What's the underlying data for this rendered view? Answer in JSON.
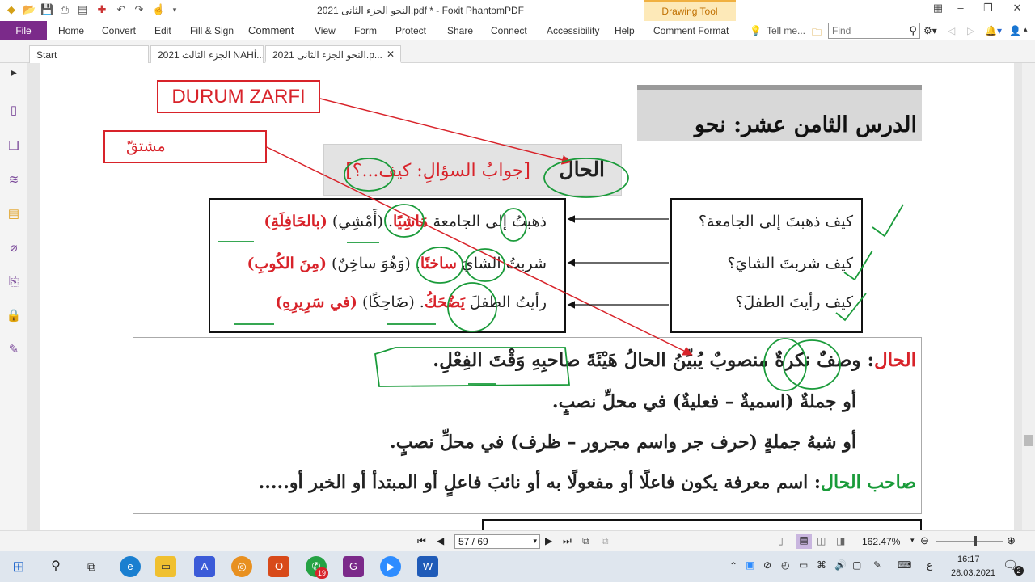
{
  "app": {
    "window_title": "النحو الجزء الثانى 2021.pdf * - Foxit PhantomPDF",
    "context_tab": "Drawing Tool"
  },
  "ribbon": {
    "file_label": "File",
    "menus": [
      "Home",
      "Convert",
      "Edit",
      "Fill & Sign",
      "Comment",
      "View",
      "Form",
      "Protect",
      "Share",
      "Connect",
      "Accessibility",
      "Help",
      "Comment Format"
    ],
    "tell_me": "Tell me...",
    "find_placeholder": "Find"
  },
  "tabs": [
    {
      "label": "Start"
    },
    {
      "label": "2021 الجزء الثالث NAHİ..."
    },
    {
      "label": "النحو الجزء الثانى 2021.p...",
      "active": true
    }
  ],
  "doc": {
    "header_title": "الدرس الثامن عشر: نحو",
    "box_zarf": "DURUM ZARFI",
    "box_mushtaq": "مشتقّ",
    "hal_heading": "الحالُ",
    "hal_question": "[جوابُ السؤالِ: كيف...؟]",
    "questions": [
      "كيف ذهبتَ إلى الجامعة؟",
      "كيف شربتَ الشايَ؟",
      "كيف رأيتَ الطفلَ؟"
    ],
    "answers": [
      {
        "lead": "ذهبتُ إلى الجامعة",
        "hal": "مَاشِيًا",
        "rest1": ". (أَمْشِي)",
        "rest2": "(بالحَافِلَةِ)"
      },
      {
        "lead": "شربتُ الشايَ",
        "hal": "ساخنًا",
        "rest1": ". (وَهُوَ ساخِنٌ)",
        "rest2": "(مِنَ الكُوبِ)"
      },
      {
        "lead": "رأيتُ الطفلَ",
        "hal": "يَضْحَكُ",
        "rest1": ". (ضَاحِكًا)",
        "rest2": "(في سَرِيرِهِ)"
      }
    ],
    "def_label": "الحال",
    "def_line1": ": وصفٌ نكرةٌ منصوبٌ يُبيِّنُ الحالُ هَيْئَةَ صاحبِهِ وَقْتَ الفِعْلِ.",
    "def_line2": "أو جملةٌ (اسميةٌ – فعليةٌ) في محلِّ نصبٍ.",
    "def_line3": "أو شبهُ جملةٍ (حرف جر واسم مجرور – ظرف) في محلِّ نصبٍ.",
    "sahib_label": "صاحب الحال",
    "sahib_text": ": اسم معرفة يكون فاعلًا أو مفعولًا به أو نائبَ فاعلٍ أو المبتدأ أو الخبر أو....."
  },
  "status": {
    "page_value": "57 / 69",
    "zoom": "162.47%"
  },
  "taskbar": {
    "time": "16:17",
    "date": "28.03.2021",
    "lang": "ع",
    "badge_whatsapp": "19",
    "notif_count": "2"
  },
  "colors": {
    "accent": "#7b2a8a",
    "red": "#d8232a",
    "green": "#1a9b3a"
  }
}
